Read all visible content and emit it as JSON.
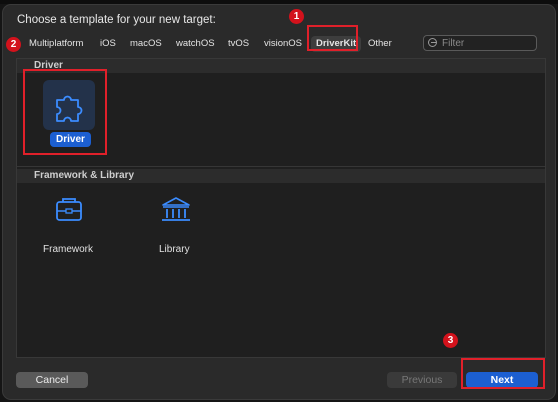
{
  "dialog": {
    "title": "Choose a template for your new target:"
  },
  "tabs": [
    {
      "label": "Multiplatform"
    },
    {
      "label": "iOS"
    },
    {
      "label": "macOS"
    },
    {
      "label": "watchOS"
    },
    {
      "label": "tvOS"
    },
    {
      "label": "visionOS"
    },
    {
      "label": "DriverKit",
      "selected": true
    },
    {
      "label": "Other"
    }
  ],
  "filter": {
    "placeholder": "Filter",
    "icon": "filter-icon"
  },
  "sections": [
    {
      "title": "Driver",
      "items": [
        {
          "label": "Driver",
          "icon": "puzzle-piece-icon",
          "selected": true
        }
      ]
    },
    {
      "title": "Framework & Library",
      "items": [
        {
          "label": "Framework",
          "icon": "toolbox-icon"
        },
        {
          "label": "Library",
          "icon": "library-building-icon"
        }
      ]
    }
  ],
  "buttons": {
    "cancel": "Cancel",
    "previous": "Previous",
    "next": "Next"
  },
  "annotations": {
    "badge1": "1",
    "badge2": "2",
    "badge3": "3"
  },
  "colors": {
    "accent": "#1c5fd1",
    "highlight_red": "#e0202a",
    "icon_blue": "#3b8cff"
  }
}
